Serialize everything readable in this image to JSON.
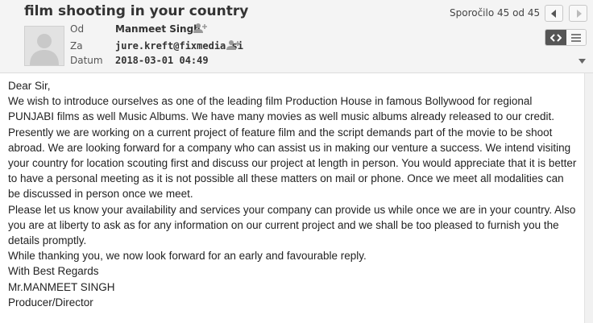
{
  "message": {
    "subject": "film shooting in your country",
    "counter": "Sporočilo 45 od 45",
    "from_label": "Od",
    "from_value": "Manmeet Singh",
    "to_label": "Za",
    "to_value": "jure.kreft@fixmedia.si",
    "date_label": "Datum",
    "date_value": "2018-03-01 04:49"
  },
  "icons": {
    "prev": "chevron-left-icon",
    "next": "chevron-right-icon",
    "add_contact": "add-contact-icon",
    "html_view": "code-icon",
    "plain_view": "menu-icon",
    "expand": "chevron-down-icon"
  },
  "colors": {
    "header_bg": "#f4f4f4",
    "active_toggle": "#555555",
    "text": "#222222"
  },
  "body_lines": [
    "Dear Sir,",
    "We wish to introduce ourselves as one of the leading film Production House in famous Bollywood for regional PUNJABI films as well Music Albums. We have many movies as well music albums already released to our credit.",
    "Presently we are working on a current project of feature film and the script demands part of the movie to be shoot abroad. We are looking forward for a company who can assist us in making our venture a success. We intend visiting your country for location scouting first and discuss our project at length in person. You would appreciate that it is better to have a personal meeting as it is not possible all these matters on mail or phone. Once we meet all modalities can be discussed in person once we meet.",
    "Please let us know your availability and services your company can provide us while once we are in your country. Also you are at liberty to ask as for any information on our current project and we shall be too pleased to furnish you the details promptly.",
    "While thanking you, we now look forward for an early and favourable reply.",
    "With Best Regards",
    "Mr.MANMEET SINGH",
    "Producer/Director"
  ]
}
